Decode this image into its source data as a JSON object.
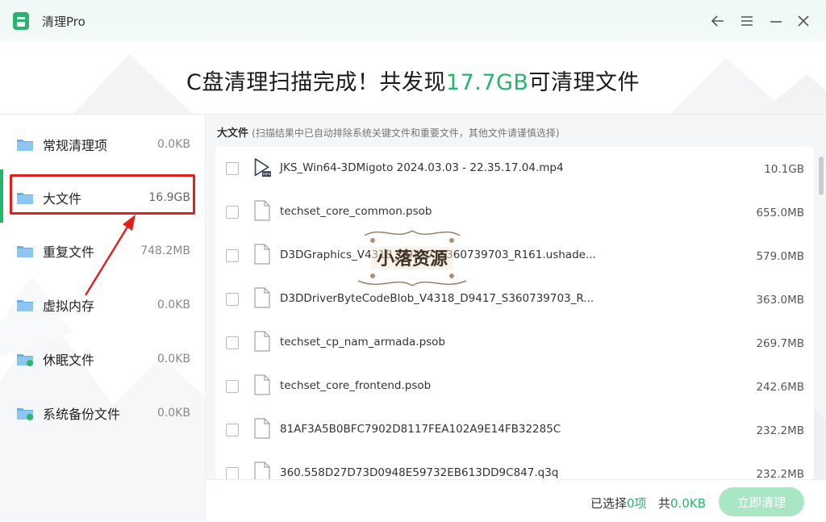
{
  "app": {
    "title": "清理Pro"
  },
  "window_controls": {
    "back": "back-arrow-icon",
    "menu": "hamburger-icon",
    "minimize": "minimize-icon",
    "close": "close-icon"
  },
  "headline": {
    "prefix": "C盘清理扫描完成！共发现",
    "amount": "17.7GB",
    "suffix": "可清理文件"
  },
  "sidebar": {
    "items": [
      {
        "label": "常规清理项",
        "size": "0.0KB",
        "icon": "folder-icon"
      },
      {
        "label": "大文件",
        "size": "16.9GB",
        "icon": "folder-icon"
      },
      {
        "label": "重复文件",
        "size": "748.2MB",
        "icon": "folder-icon"
      },
      {
        "label": "虚拟内存",
        "size": "0.0KB",
        "icon": "folder-icon"
      },
      {
        "label": "休眠文件",
        "size": "0.0KB",
        "icon": "folder-icon"
      },
      {
        "label": "系统备份文件",
        "size": "0.0KB",
        "icon": "folder-icon"
      }
    ],
    "active_index": 1
  },
  "section": {
    "title": "大文件",
    "hint": "(扫描结果中已自动排除系统关键文件和重要文件，其他文件请谨慎选择)"
  },
  "files": [
    {
      "name": "JKS_Win64-3DMigoto 2024.03.03 - 22.35.17.04.mp4",
      "size": "10.1GB",
      "icon": "video-file-icon",
      "badge": "MP4"
    },
    {
      "name": "techset_core_common.psob",
      "size": "655.0MB",
      "icon": "file-icon"
    },
    {
      "name": "D3DGraphics_V4318_D9417_S360739703_R161.ushade...",
      "size": "579.0MB",
      "icon": "file-icon"
    },
    {
      "name": "D3DDriverByteCodeBlob_V4318_D9417_S360739703_R...",
      "size": "363.0MB",
      "icon": "file-icon"
    },
    {
      "name": "techset_cp_nam_armada.psob",
      "size": "269.7MB",
      "icon": "file-icon"
    },
    {
      "name": "techset_core_frontend.psob",
      "size": "242.6MB",
      "icon": "file-icon"
    },
    {
      "name": "81AF3A5B0BFC7902D8117FEA102A9E14FB32285C",
      "size": "232.2MB",
      "icon": "file-icon"
    },
    {
      "name": "360.558D27D73D0948E59732EB613DD9C847.q3q",
      "size": "232.2MB",
      "icon": "file-icon"
    }
  ],
  "footer": {
    "selected_prefix": "已选择",
    "selected_count": "0项",
    "total_prefix": "共",
    "total_size": "0.0KB",
    "clean_button": "立即清理"
  },
  "colors": {
    "accent": "#22b86a",
    "highlight_box": "#e0201b",
    "button_disabled": "#a9e6c4"
  },
  "watermark": {
    "text": "小落资源"
  }
}
